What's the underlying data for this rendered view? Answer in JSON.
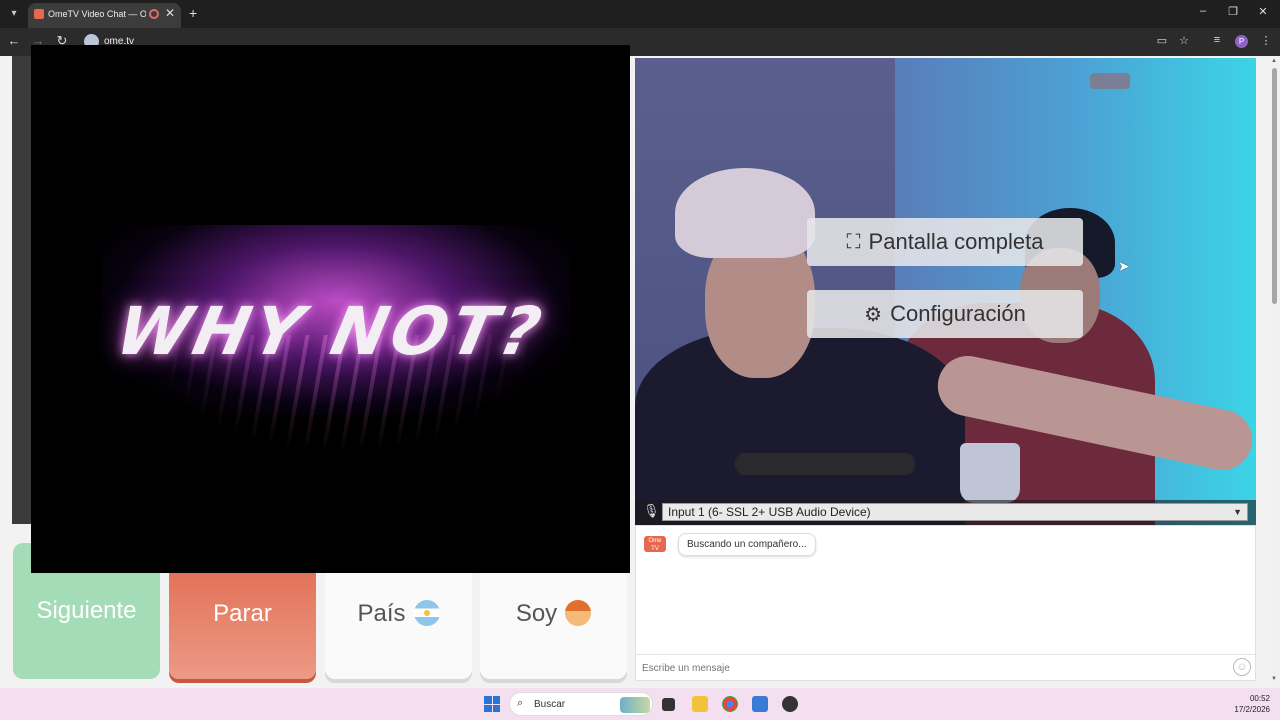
{
  "browser": {
    "tab_title": "OmeTV Video Chat — Ome",
    "url": "ome.tv",
    "profile_initial": "P"
  },
  "screen_share": {
    "headline": "WHY NOT?"
  },
  "video_overlay": {
    "fullscreen_label": "Pantalla completa",
    "settings_label": "Configuración"
  },
  "audio": {
    "selected_device": "Input 1 (6- SSL 2+ USB Audio Device)"
  },
  "chat": {
    "logo_text": "Ome TV",
    "status_message": "Buscando un compañero...",
    "input_placeholder": "Escribe un mensaje"
  },
  "buttons": {
    "next": "Siguiente",
    "stop": "Parar",
    "country": "País",
    "iam": "Soy"
  },
  "taskbar": {
    "search_placeholder": "Buscar",
    "time": "00:52",
    "date": "17/2/2026"
  },
  "colors": {
    "next_button": "#a4dcb8",
    "stop_button": "#e0684c",
    "brand": "#e8674f"
  }
}
